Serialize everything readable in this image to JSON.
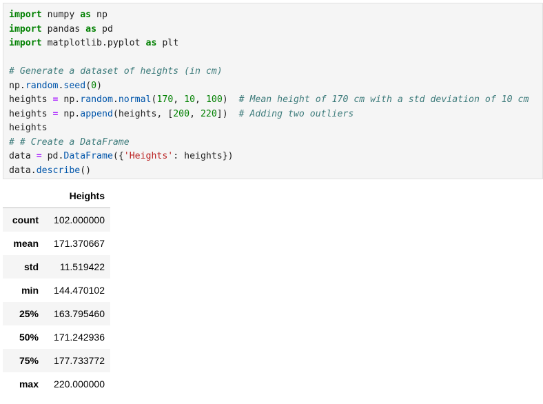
{
  "code_lines": [
    [
      {
        "t": "import",
        "c": "kw"
      },
      {
        "t": " numpy "
      },
      {
        "t": "as",
        "c": "kw"
      },
      {
        "t": " np"
      }
    ],
    [
      {
        "t": "import",
        "c": "kw"
      },
      {
        "t": " pandas "
      },
      {
        "t": "as",
        "c": "kw"
      },
      {
        "t": " pd"
      }
    ],
    [
      {
        "t": "import",
        "c": "kw"
      },
      {
        "t": " matplotlib.pyplot "
      },
      {
        "t": "as",
        "c": "kw"
      },
      {
        "t": " plt"
      }
    ],
    [],
    [
      {
        "t": "# Generate a dataset of heights (in cm)",
        "c": "cmt"
      }
    ],
    [
      {
        "t": "np."
      },
      {
        "t": "random",
        "c": "call"
      },
      {
        "t": "."
      },
      {
        "t": "seed",
        "c": "call"
      },
      {
        "t": "("
      },
      {
        "t": "0",
        "c": "num"
      },
      {
        "t": ")"
      }
    ],
    [
      {
        "t": "heights "
      },
      {
        "t": "=",
        "c": "op"
      },
      {
        "t": " np."
      },
      {
        "t": "random",
        "c": "call"
      },
      {
        "t": "."
      },
      {
        "t": "normal",
        "c": "call"
      },
      {
        "t": "("
      },
      {
        "t": "170",
        "c": "num"
      },
      {
        "t": ", "
      },
      {
        "t": "10",
        "c": "num"
      },
      {
        "t": ", "
      },
      {
        "t": "100",
        "c": "num"
      },
      {
        "t": ")  "
      },
      {
        "t": "# Mean height of 170 cm with a std deviation of 10 cm",
        "c": "cmt"
      }
    ],
    [
      {
        "t": "heights "
      },
      {
        "t": "=",
        "c": "op"
      },
      {
        "t": " np."
      },
      {
        "t": "append",
        "c": "call"
      },
      {
        "t": "(heights, ["
      },
      {
        "t": "200",
        "c": "num"
      },
      {
        "t": ", "
      },
      {
        "t": "220",
        "c": "num"
      },
      {
        "t": "])  "
      },
      {
        "t": "# Adding two outliers",
        "c": "cmt"
      }
    ],
    [
      {
        "t": "heights"
      }
    ],
    [
      {
        "t": "# # Create a DataFrame",
        "c": "cmt"
      }
    ],
    [
      {
        "t": "data "
      },
      {
        "t": "=",
        "c": "op"
      },
      {
        "t": " pd."
      },
      {
        "t": "DataFrame",
        "c": "call"
      },
      {
        "t": "({"
      },
      {
        "t": "'Heights'",
        "c": "str"
      },
      {
        "t": ": heights})"
      }
    ],
    [
      {
        "t": "data."
      },
      {
        "t": "describe",
        "c": "call"
      },
      {
        "t": "()"
      }
    ]
  ],
  "table": {
    "columns": [
      "Heights"
    ],
    "rows": [
      {
        "label": "count",
        "value": "102.000000"
      },
      {
        "label": "mean",
        "value": "171.370667"
      },
      {
        "label": "std",
        "value": "11.519422"
      },
      {
        "label": "min",
        "value": "144.470102"
      },
      {
        "label": "25%",
        "value": "163.795460"
      },
      {
        "label": "50%",
        "value": "171.242936"
      },
      {
        "label": "75%",
        "value": "177.733772"
      },
      {
        "label": "max",
        "value": "220.000000"
      }
    ]
  }
}
